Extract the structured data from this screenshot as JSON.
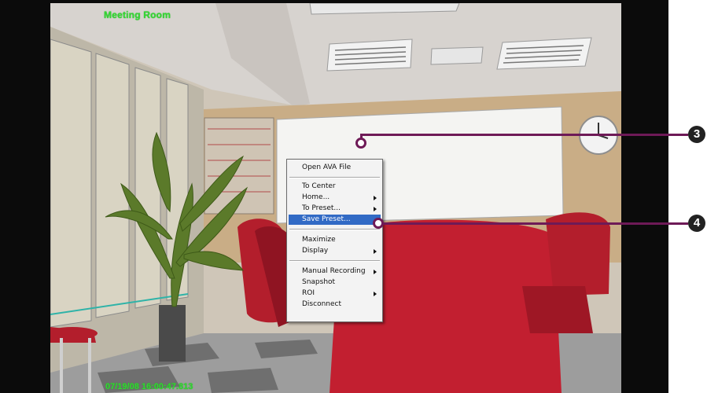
{
  "video": {
    "overlay_title": "Meeting Room",
    "timestamp": "07/19/08 16:00:47.813"
  },
  "context_menu": {
    "items": [
      {
        "label": "Open AVA File",
        "submenu": false
      },
      {
        "label": "To Center",
        "submenu": false
      },
      {
        "label": "Home...",
        "submenu": true
      },
      {
        "label": "To Preset...",
        "submenu": true
      },
      {
        "label": "Save Preset...",
        "submenu": false,
        "highlighted": true
      },
      {
        "label": "Maximize",
        "submenu": false
      },
      {
        "label": "Display",
        "submenu": true
      },
      {
        "label": "Manual Recording",
        "submenu": true
      },
      {
        "label": "Snapshot",
        "submenu": false
      },
      {
        "label": "ROI",
        "submenu": true
      },
      {
        "label": "Disconnect",
        "submenu": false
      }
    ]
  },
  "callouts": [
    {
      "number": "3"
    },
    {
      "number": "4"
    }
  ],
  "colors": {
    "osd_text": "#35d635",
    "menu_highlight": "#316ac5",
    "callout_line": "#6e1a57",
    "badge": "#222222"
  }
}
